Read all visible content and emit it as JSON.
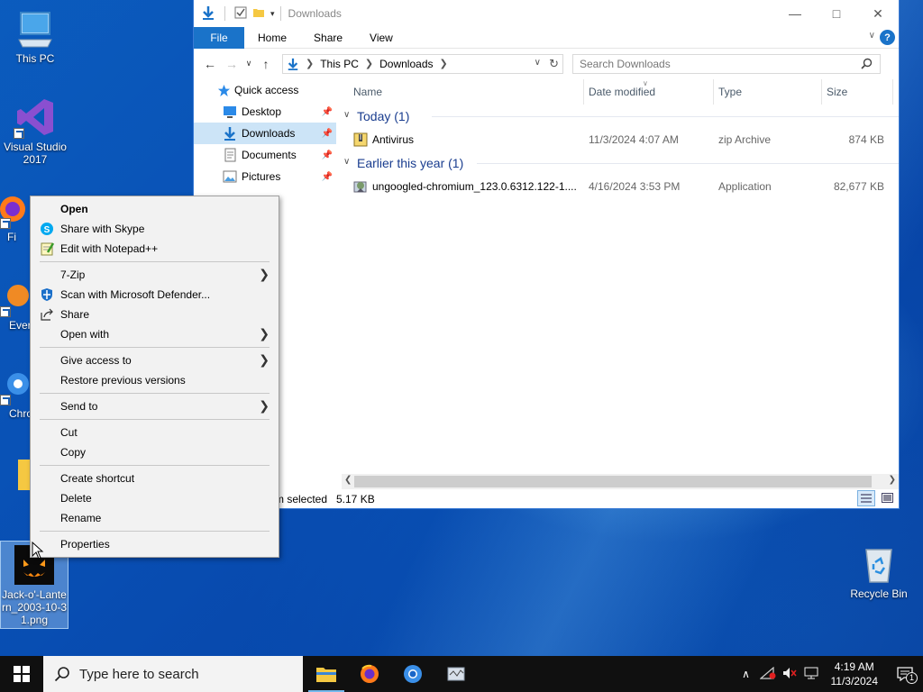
{
  "desktop": {
    "icons": [
      {
        "label": "This PC"
      },
      {
        "label": "Visual Studio 2017"
      },
      {
        "label": "Fi"
      },
      {
        "label": "Ever"
      },
      {
        "label": "Chro"
      },
      {
        "label": "Jack-o'-Lantern_2003-10-31.png"
      },
      {
        "label": "Recycle Bin"
      }
    ]
  },
  "explorer": {
    "title": "Downloads",
    "ribbon": {
      "file": "File",
      "home": "Home",
      "share": "Share",
      "view": "View",
      "help": "?"
    },
    "address": {
      "root": "This PC",
      "folder": "Downloads"
    },
    "search_placeholder": "Search Downloads",
    "nav": [
      {
        "label": "Quick access",
        "icon": "star-icon"
      },
      {
        "label": "Desktop",
        "icon": "desktop-folder-icon"
      },
      {
        "label": "Downloads",
        "icon": "downloads-folder-icon",
        "selected": true
      },
      {
        "label": "Documents",
        "icon": "documents-folder-icon"
      },
      {
        "label": "Pictures",
        "icon": "pictures-folder-icon"
      }
    ],
    "columns": {
      "name": "Name",
      "date": "Date modified",
      "type": "Type",
      "size": "Size"
    },
    "groups": [
      {
        "title": "Today (1)",
        "files": [
          {
            "name": "Antivirus",
            "date": "11/3/2024 4:07 AM",
            "type": "zip Archive",
            "size": "874 KB"
          }
        ]
      },
      {
        "title": "Earlier this year (1)",
        "files": [
          {
            "name": "ungoogled-chromium_123.0.6312.122-1....",
            "date": "4/16/2024 3:53 PM",
            "type": "Application",
            "size": "82,677 KB"
          }
        ]
      }
    ],
    "status": {
      "selection": "m selected",
      "size": "5.17 KB"
    }
  },
  "context_menu": {
    "items": [
      {
        "label": "Open",
        "bold": true
      },
      {
        "label": "Share with Skype",
        "icon": "skype-icon"
      },
      {
        "label": "Edit with Notepad++",
        "icon": "notepad-plus-plus-icon"
      },
      {
        "label": "7-Zip",
        "submenu": true
      },
      {
        "label": "Scan with Microsoft Defender...",
        "icon": "defender-shield-icon"
      },
      {
        "label": "Share",
        "icon": "share-icon"
      },
      {
        "label": "Open with",
        "submenu": true
      },
      {
        "label": "Give access to",
        "submenu": true
      },
      {
        "label": "Restore previous versions"
      },
      {
        "label": "Send to",
        "submenu": true
      },
      {
        "label": "Cut"
      },
      {
        "label": "Copy"
      },
      {
        "label": "Create shortcut"
      },
      {
        "label": "Delete"
      },
      {
        "label": "Rename"
      },
      {
        "label": "Properties"
      }
    ]
  },
  "taskbar": {
    "search_placeholder": "Type here to search",
    "apps": [
      "file-explorer-icon",
      "firefox-icon",
      "chromium-icon",
      "network-app-icon"
    ],
    "clock": {
      "time": "4:19 AM",
      "date": "11/3/2024"
    },
    "notification_count": "1"
  },
  "colors": {
    "accent": "#1a73c9",
    "selection": "#cce4f7",
    "taskbar": "#101010"
  }
}
